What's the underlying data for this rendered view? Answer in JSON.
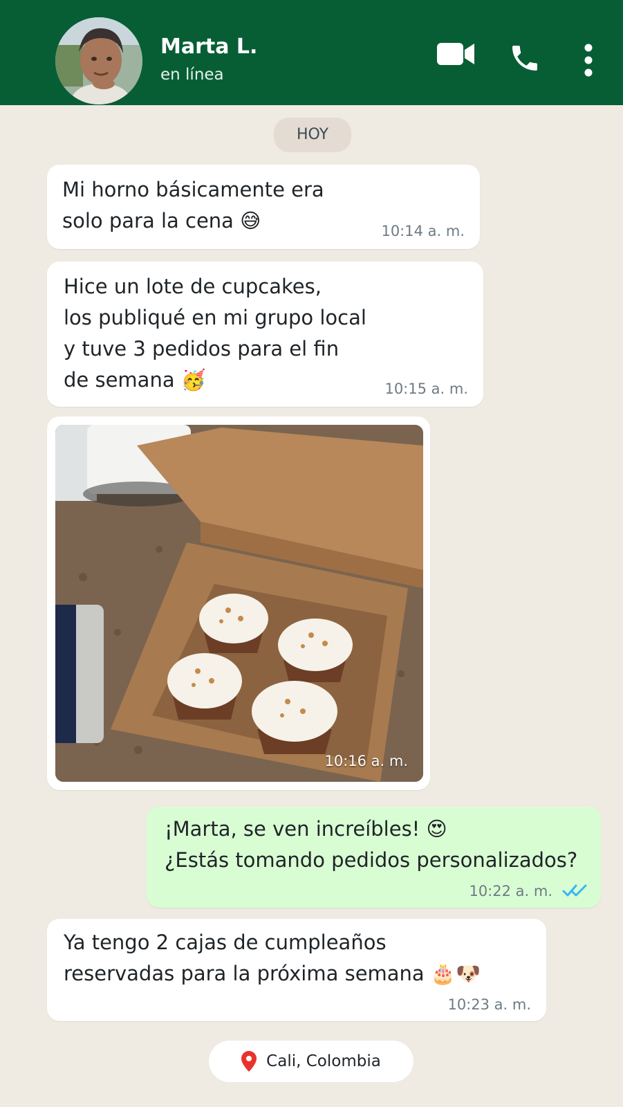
{
  "header": {
    "contact_name": "Marta L.",
    "status": "en línea"
  },
  "chat": {
    "day_label": "HOY",
    "messages": [
      {
        "direction": "in",
        "text": "Mi horno básicamente era\nsolo para la cena 😅",
        "time": "10:14 a. m."
      },
      {
        "direction": "in",
        "text": "Hice un lote de cupcakes,\nlos publiqué en mi grupo local\ny tuve 3 pedidos para el fin\nde semana 🥳",
        "time": "10:15 a. m."
      },
      {
        "direction": "in",
        "type": "photo",
        "time": "10:16 a. m."
      },
      {
        "direction": "out",
        "text": "¡Marta, se ven increíbles! 😍\n¿Estás tomando pedidos personalizados?",
        "time": "10:22 a. m.",
        "read": true
      },
      {
        "direction": "in",
        "text": "Ya tengo 2 cajas de cumpleaños\nreservadas para la próxima semana 🎂🐶",
        "time": "10:23 a. m."
      }
    ],
    "location": "Cali, Colombia"
  },
  "colors": {
    "header": "#075e35",
    "chat_background": "#efeae2",
    "outgoing_bubble": "#d9fdd3",
    "incoming_bubble": "#ffffff",
    "read_ticks": "#34b7f1"
  },
  "icons": [
    "video-camera-icon",
    "phone-icon",
    "more-options-icon",
    "location-pin-icon",
    "double-check-icon"
  ]
}
